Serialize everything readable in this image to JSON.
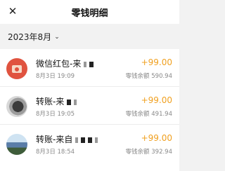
{
  "header": {
    "title": "零钱明细",
    "close_icon": "close-icon"
  },
  "filter": {
    "month": "2023年8月",
    "chevron_icon": "chevron-down-icon"
  },
  "transactions": [
    {
      "title": "微信红包-来",
      "date": "8月3日 19:09",
      "amount": "+99.00",
      "balance": "零钱余额 590.94",
      "avatar": "red-packet-icon"
    },
    {
      "title": "转账-来",
      "date": "8月3日 19:05",
      "amount": "+99.00",
      "balance": "零钱余额 491.94",
      "avatar": "user-avatar"
    },
    {
      "title": "转账-来自",
      "date": "8月3日 18:54",
      "amount": "+99.00",
      "balance": "零钱余额 392.94",
      "avatar": "user-avatar"
    }
  ],
  "colors": {
    "amount": "#f0a020",
    "background": "#f2f2f2",
    "red_packet": "#e0533f"
  }
}
